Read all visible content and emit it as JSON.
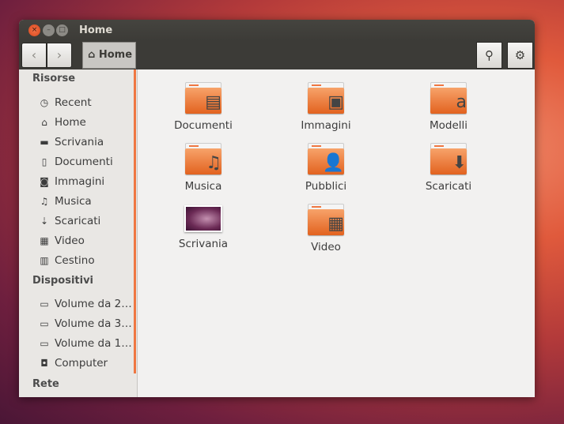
{
  "window": {
    "title": "Home",
    "close": "×",
    "minimize": "–",
    "maximize": "□"
  },
  "toolbar": {
    "back": "‹",
    "forward": "›",
    "breadcrumb": "Home",
    "search": "🔍",
    "settings": "⚙"
  },
  "sidebar": {
    "sections": [
      {
        "title": "Risorse",
        "items": [
          {
            "label": "Recent",
            "icon": "◷"
          },
          {
            "label": "Home",
            "icon": "⌂"
          },
          {
            "label": "Scrivania",
            "icon": "▬"
          },
          {
            "label": "Documenti",
            "icon": "▯"
          },
          {
            "label": "Immagini",
            "icon": "◙"
          },
          {
            "label": "Musica",
            "icon": "♫"
          },
          {
            "label": "Scaricati",
            "icon": "⇣"
          },
          {
            "label": "Video",
            "icon": "▦"
          },
          {
            "label": "Cestino",
            "icon": "▥"
          }
        ]
      },
      {
        "title": "Dispositivi",
        "items": [
          {
            "label": "Volume da 2…",
            "icon": "▭"
          },
          {
            "label": "Volume da 3…",
            "icon": "▭"
          },
          {
            "label": "Volume da 1…",
            "icon": "▭"
          },
          {
            "label": "Computer",
            "icon": "◘"
          }
        ]
      },
      {
        "title": "Rete",
        "items": []
      }
    ]
  },
  "files": [
    {
      "name": "Documenti",
      "emblem": "▤"
    },
    {
      "name": "Immagini",
      "emblem": "▣"
    },
    {
      "name": "Modelli",
      "emblem": "a"
    },
    {
      "name": "Musica",
      "emblem": "♫"
    },
    {
      "name": "Pubblici",
      "emblem": "👤"
    },
    {
      "name": "Scaricati",
      "emblem": "⬇"
    },
    {
      "name": "Scrivania",
      "emblem": ""
    },
    {
      "name": "Video",
      "emblem": "▦"
    }
  ]
}
